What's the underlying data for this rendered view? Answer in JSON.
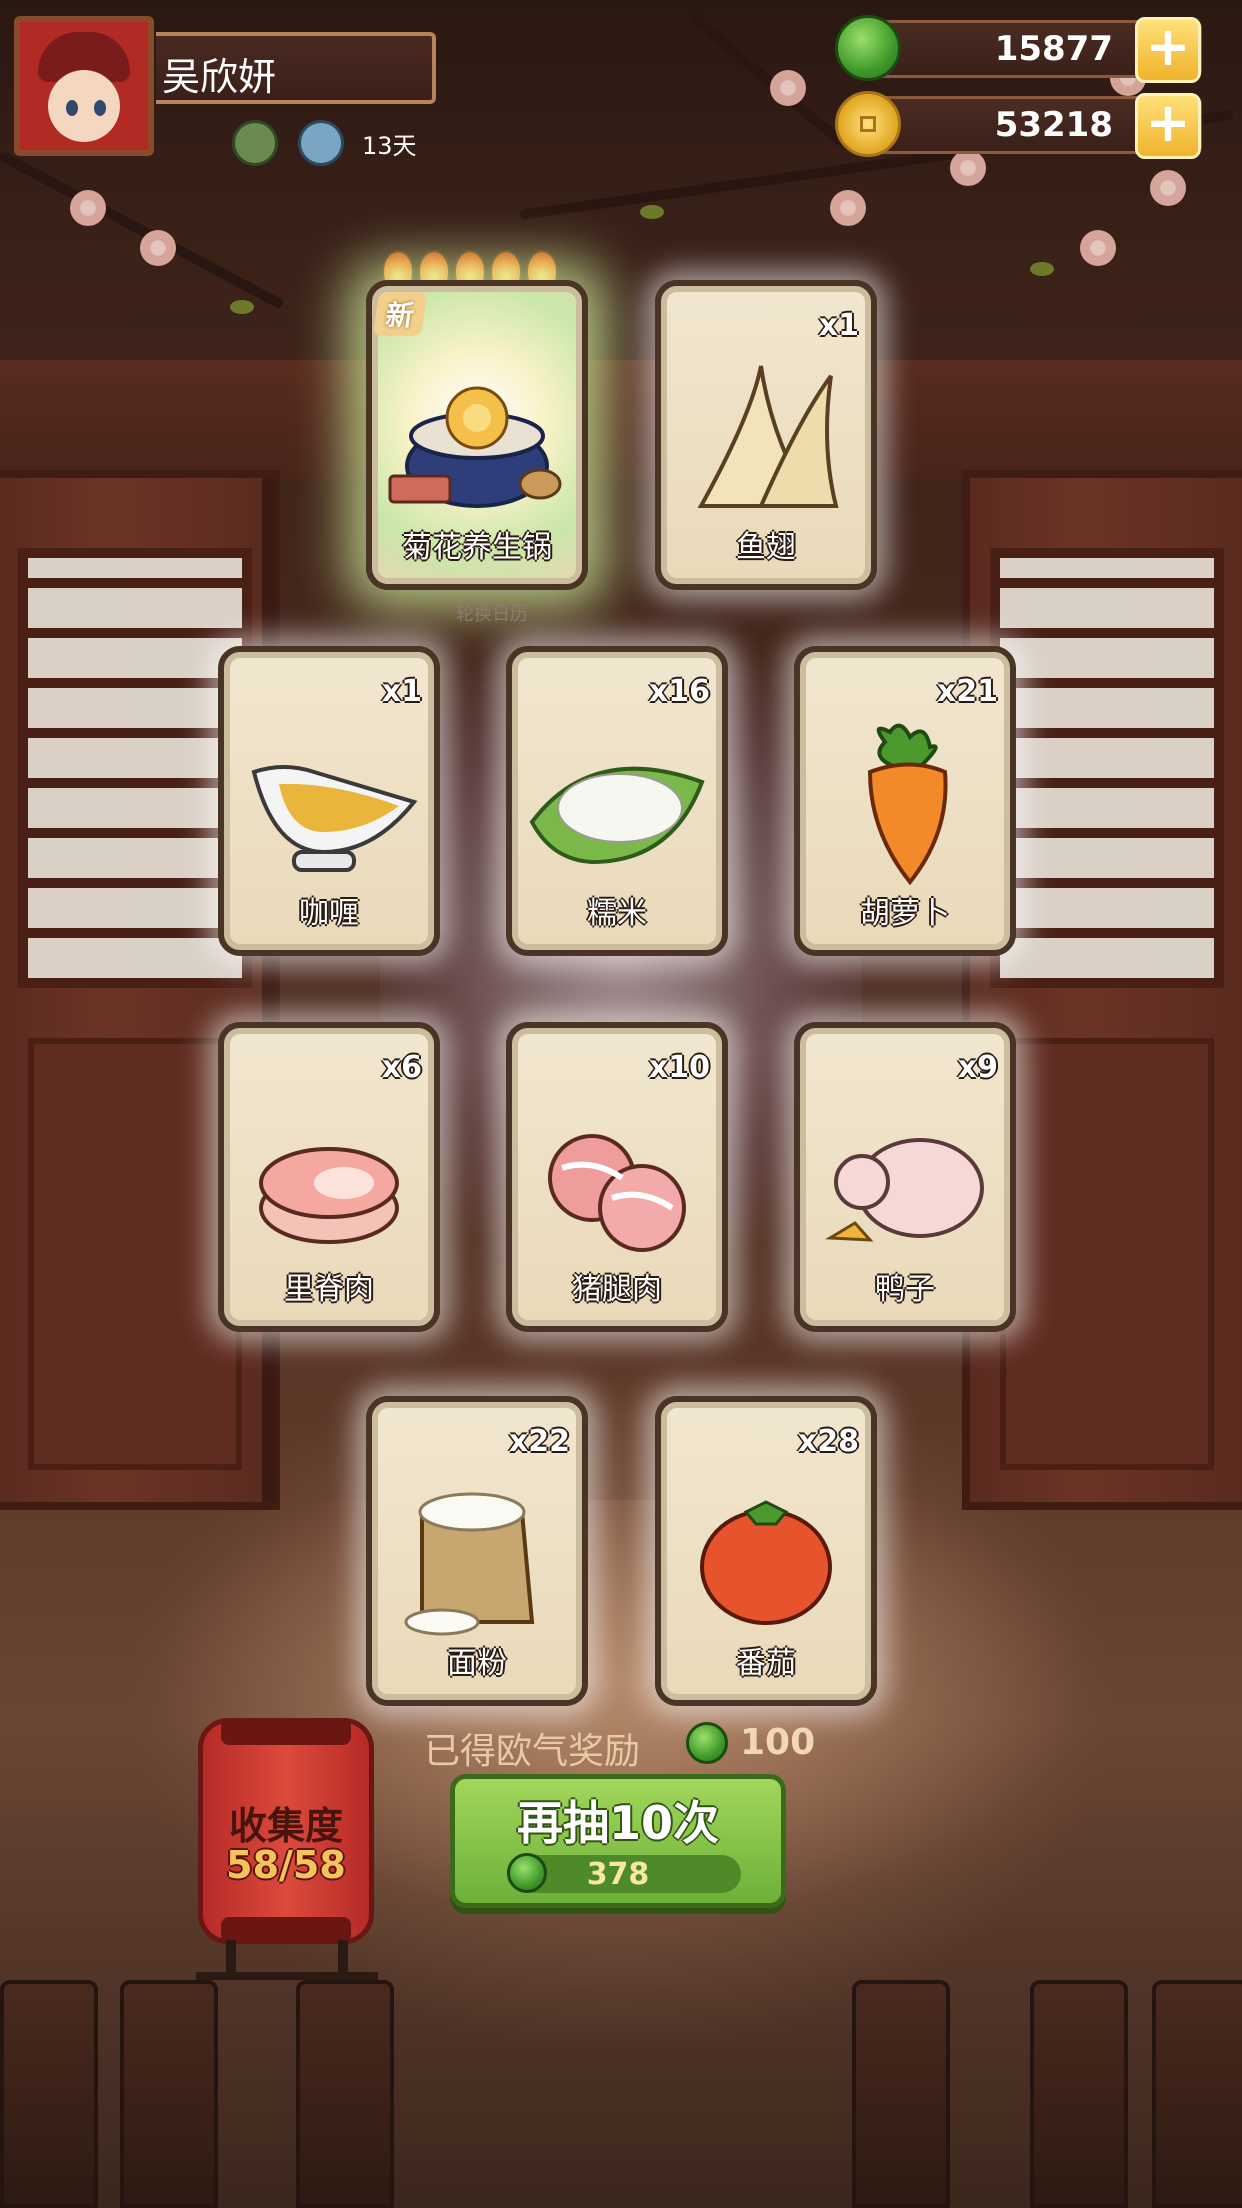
{
  "player": {
    "name": "吴欣妍",
    "days_label": "13天"
  },
  "currency": {
    "jade": {
      "value": "15877",
      "plus_label": "+"
    },
    "coins": {
      "value": "53218",
      "plus_label": "+"
    }
  },
  "calendar_caption": "轮换日历",
  "featured_card": {
    "name": "菊花养生锅",
    "badge": "新",
    "stars": 5
  },
  "cards": [
    {
      "name": "鱼翅",
      "qty": "x1"
    },
    {
      "name": "咖喱",
      "qty": "x1"
    },
    {
      "name": "糯米",
      "qty": "x16"
    },
    {
      "name": "胡萝卜",
      "qty": "x21"
    },
    {
      "name": "里脊肉",
      "qty": "x6"
    },
    {
      "name": "猪腿肉",
      "qty": "x10"
    },
    {
      "name": "鸭子",
      "qty": "x9"
    },
    {
      "name": "面粉",
      "qty": "x22"
    },
    {
      "name": "番茄",
      "qty": "x28"
    }
  ],
  "reward": {
    "text": "已得欧气奖励",
    "value": "100"
  },
  "collection": {
    "label": "收集度",
    "value": "58/58"
  },
  "draw_button": {
    "label": "再抽10次",
    "cost": "378"
  },
  "colors": {
    "jade": "#4aa830",
    "gold": "#f0b32c",
    "button_green": "#7cc043",
    "lantern_red": "#cc3a30"
  }
}
